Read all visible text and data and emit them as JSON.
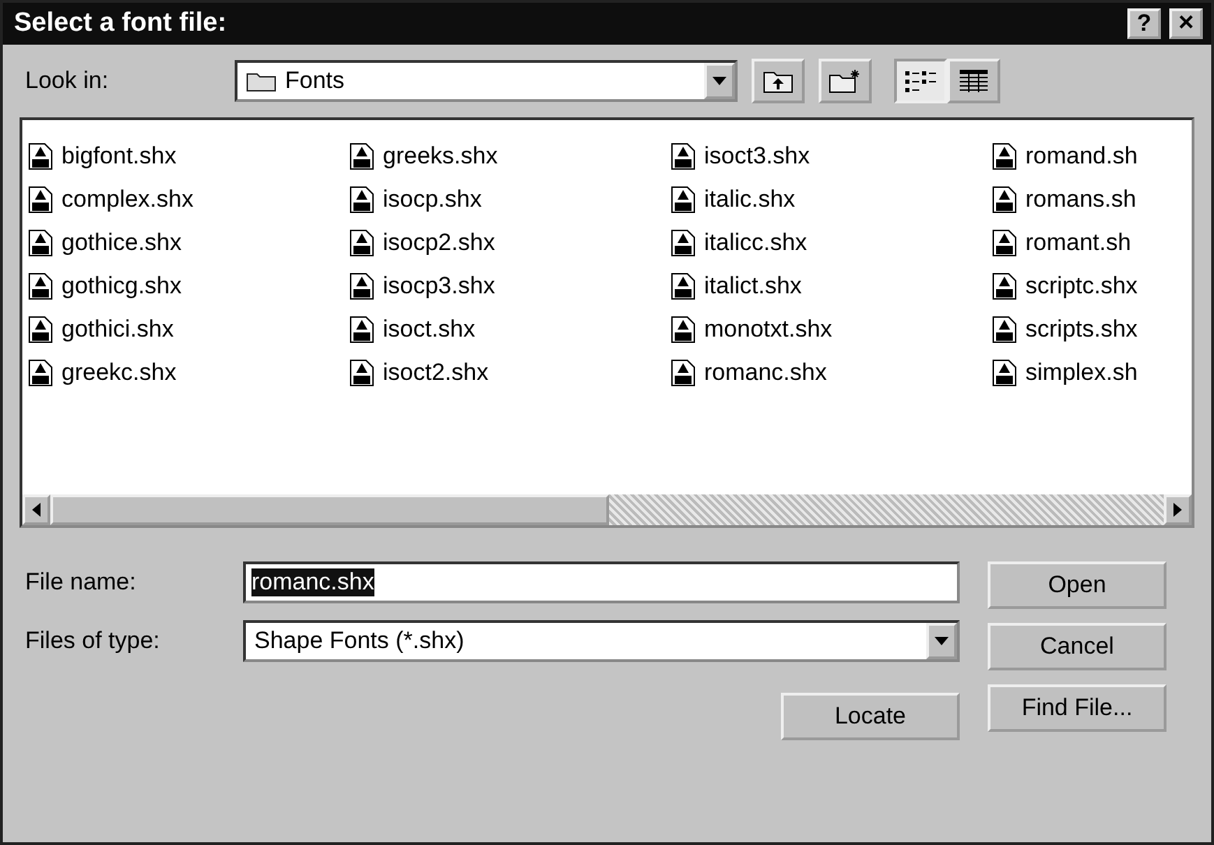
{
  "window": {
    "title": "Select a font file:",
    "title_buttons": [
      {
        "kind": "help",
        "label": "?"
      },
      {
        "kind": "close",
        "label": "×"
      }
    ]
  },
  "look_in": {
    "label": "Look in:",
    "value": "Fonts"
  },
  "files": [
    {
      "name": "bigfont.shx"
    },
    {
      "name": "complex.shx"
    },
    {
      "name": "gothice.shx"
    },
    {
      "name": "gothicg.shx"
    },
    {
      "name": "gothici.shx"
    },
    {
      "name": "greekc.shx"
    },
    {
      "name": "greeks.shx"
    },
    {
      "name": "isocp.shx"
    },
    {
      "name": "isocp2.shx"
    },
    {
      "name": "isocp3.shx"
    },
    {
      "name": "isoct.shx"
    },
    {
      "name": "isoct2.shx"
    },
    {
      "name": "isoct3.shx"
    },
    {
      "name": "italic.shx"
    },
    {
      "name": "italicc.shx"
    },
    {
      "name": "italict.shx"
    },
    {
      "name": "monotxt.shx"
    },
    {
      "name": "romanc.shx"
    },
    {
      "name": "romand.sh"
    },
    {
      "name": "romans.sh"
    },
    {
      "name": "romant.sh"
    },
    {
      "name": "scriptc.shx"
    },
    {
      "name": "scripts.shx"
    },
    {
      "name": "simplex.sh"
    }
  ],
  "file_name": {
    "label": "File name:",
    "value": "romanc.shx",
    "value_selected": true
  },
  "file_type": {
    "label": "Files of type:",
    "value": "Shape Fonts (*.shx)"
  },
  "buttons": [
    {
      "kind": "open",
      "label": "Open"
    },
    {
      "kind": "cancel",
      "label": "Cancel"
    },
    {
      "kind": "locate",
      "label": "Locate"
    },
    {
      "kind": "find",
      "label": "Find File..."
    }
  ]
}
